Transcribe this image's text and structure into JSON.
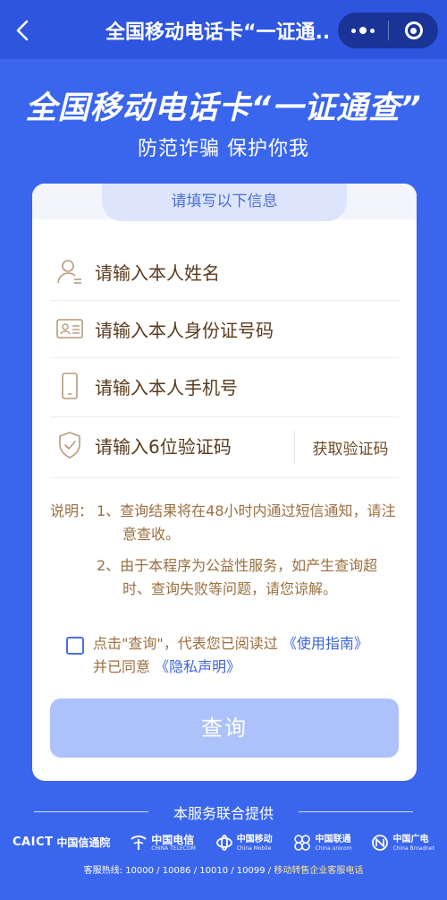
{
  "nav": {
    "title": "全国移动电话卡“一证通..."
  },
  "hero": {
    "title": "全国移动电话卡“一证通查”",
    "subtitle": "防范诈骗 保护你我"
  },
  "form": {
    "header": "请填写以下信息",
    "name_placeholder": "请输入本人姓名",
    "id_placeholder": "请输入本人身份证号码",
    "phone_placeholder": "请输入本人手机号",
    "code_placeholder": "请输入6位验证码",
    "get_code_label": "获取验证码"
  },
  "notes": {
    "label": "说明：",
    "item1_line1": "1、查询结果将在48小时内通过短信通知，请注",
    "item1_line2": "意查收。",
    "item2_line1": "2、由于本程序为公益性服务，如产生查询超",
    "item2_line2": "时、查询失败等问题，请您谅解。"
  },
  "agreement": {
    "text1": "点击\"查询\"，代表您已阅读过",
    "link1": "《使用指南》",
    "text2": "并已同意",
    "link2": "《隐私声明》",
    "checked": false
  },
  "query_button": "查询",
  "footer": {
    "provided_by": "本服务联合提供",
    "logos": {
      "caict_abbr": "CAICT",
      "caict_name": "中国信通院",
      "telecom_cn": "中国电信",
      "telecom_en": "CHINA TELECOM",
      "mobile_cn": "中国移动",
      "mobile_en": "China Mobile",
      "unicom_cn": "中国联通",
      "unicom_en": "China unicom",
      "broadnet_cn": "中国广电",
      "broadnet_en": "China Broadnet"
    },
    "hotline_text": "客服热线: 10000 / 10086 / 10010 / 10099 /",
    "hotline_link": "移动转售企业客服电话"
  },
  "colors": {
    "background": "#3a66ee",
    "accent": "#4e6fd6",
    "button_disabled": "#adc2fb",
    "field_text": "#5a3b1c",
    "note_text": "#9b6f3f"
  }
}
